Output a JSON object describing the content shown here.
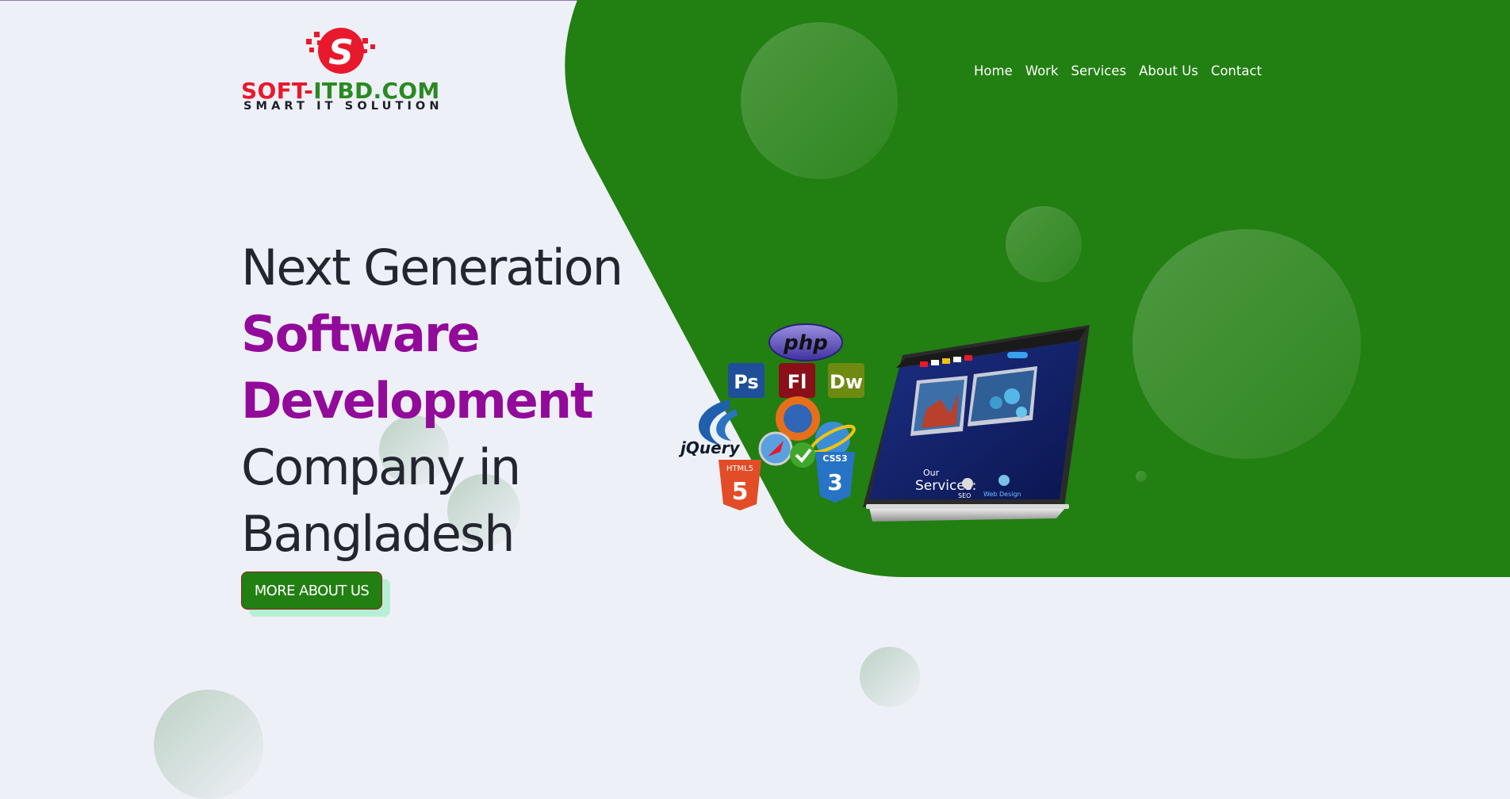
{
  "brand": {
    "name_part1": "SOFT-",
    "name_part2": "ITBD.COM",
    "tagline": "SMART IT SOLUTION",
    "logo_letter": "S",
    "colors": {
      "red": "#e8192c",
      "green": "#2a8a21",
      "dark": "#1e1e28"
    }
  },
  "nav": {
    "items": [
      {
        "label": "Home"
      },
      {
        "label": "Work"
      },
      {
        "label": "Services"
      },
      {
        "label": "About Us"
      },
      {
        "label": "Contact"
      }
    ]
  },
  "hero": {
    "line1": "Next Generation",
    "line2": "Software",
    "line3": "Development",
    "line4": "Company in",
    "line5": "Bangladesh",
    "cta_label": "MORE ABOUT US"
  },
  "illustration": {
    "php": "php",
    "ps": "Ps",
    "fl": "Fl",
    "dw": "Dw",
    "jquery": "jQuery",
    "html5": "HTML5",
    "css3": "CSS3",
    "screen_our": "Our",
    "screen_services": "Services:",
    "screen_seo": "SEO",
    "screen_web": "Web Design"
  },
  "colors": {
    "page_bg": "#eef0f8",
    "hero_green": "#227f12",
    "accent_purple": "#920a9a",
    "text_dark": "#23262f",
    "button_shadow": "#b6f0d4",
    "button_border": "#9a1e1e"
  }
}
